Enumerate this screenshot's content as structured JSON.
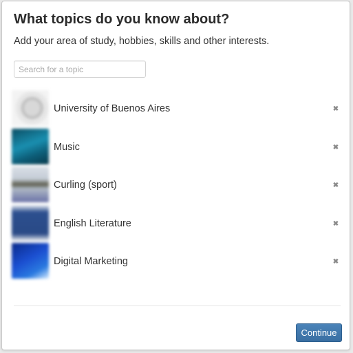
{
  "dialog": {
    "title": "What topics do you know about?",
    "subtitle": "Add your area of study, hobbies, skills and other interests.",
    "search": {
      "placeholder": "Search for a topic",
      "value": ""
    },
    "continue_label": "Continue",
    "remove_glyph": "✖",
    "accent_color": "#3b72a6"
  },
  "topics": [
    {
      "label": "University of Buenos Aires",
      "icon": "university-seal-thumbnail"
    },
    {
      "label": "Music",
      "icon": "music-thumbnail"
    },
    {
      "label": "Curling (sport)",
      "icon": "curling-thumbnail"
    },
    {
      "label": "English Literature",
      "icon": "book-thumbnail"
    },
    {
      "label": "Digital Marketing",
      "icon": "digital-marketing-thumbnail"
    }
  ]
}
